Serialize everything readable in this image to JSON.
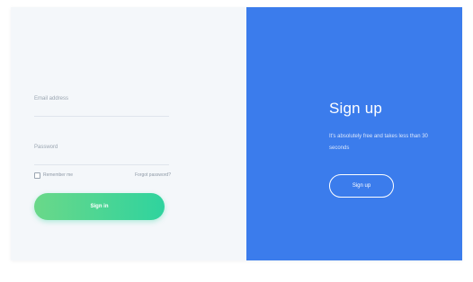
{
  "login": {
    "email_label": "Email address",
    "email_value": "",
    "password_label": "Password",
    "password_value": "",
    "remember_label": "Remember me",
    "forgot_label": "Forgot password?",
    "signin_label": "Sign in"
  },
  "signup": {
    "title": "Sign up",
    "description": "It's absolutely free and takes less than 30 seconds",
    "button_label": "Sign up"
  },
  "colors": {
    "login_bg": "#f4f7fa",
    "signup_bg": "#3b7cec",
    "button_gradient_start": "#6ad889",
    "button_gradient_end": "#2fd39e"
  }
}
